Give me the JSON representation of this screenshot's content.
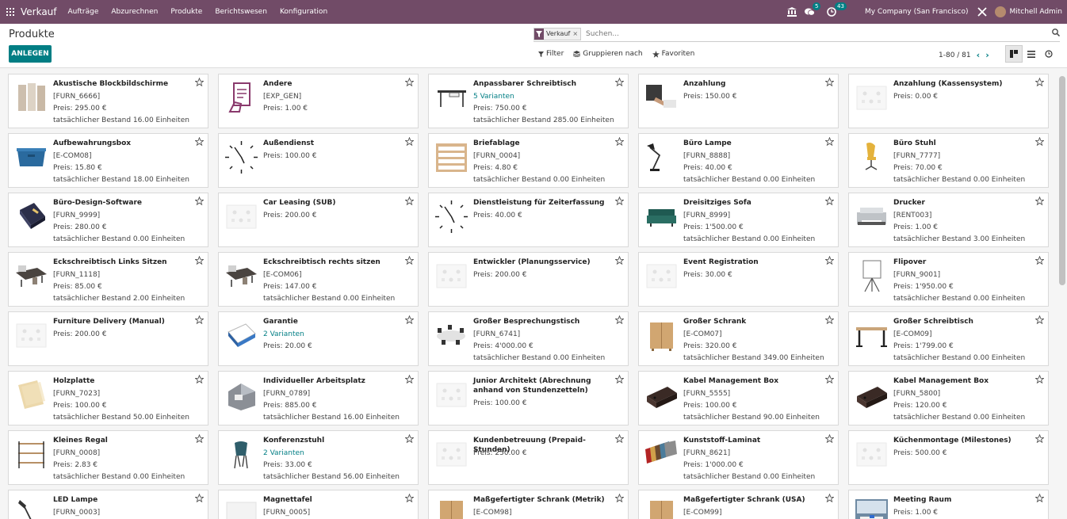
{
  "navbar": {
    "app": "Verkauf",
    "menu": [
      "Aufträge",
      "Abzurechnen",
      "Produkte",
      "Berichtswesen",
      "Konfiguration"
    ],
    "messages_count": "5",
    "activities_count": "43",
    "company": "My Company (San Francisco)",
    "user": "Mitchell Admin"
  },
  "control": {
    "title": "Produkte",
    "create_label": "ANLEGEN",
    "facet": "Verkauf",
    "search_placeholder": "Suchen...",
    "filter_label": "Filter",
    "group_label": "Gruppieren nach",
    "favorites_label": "Favoriten",
    "pager": "1-80 / 81"
  },
  "products": [
    {
      "name": "Akustische Blockbildschirme",
      "lines": [
        "[FURN_6666]",
        "Preis: 295.00 €",
        "tatsächlicher Bestand 16.00 Einheiten"
      ],
      "img": "panels"
    },
    {
      "name": "Andere",
      "lines": [
        "[EXP_GEN]",
        "Preis: 1.00 €"
      ],
      "img": "hand-doc"
    },
    {
      "name": "Anpassbarer Schreibtisch",
      "lines": [
        "5 Varianten",
        "Preis: 750.00 €",
        "tatsächlicher Bestand 285.00 Einheiten"
      ],
      "variant_line": 0,
      "img": "desk"
    },
    {
      "name": "Anzahlung",
      "lines": [
        "Preis: 150.00 €"
      ],
      "img": "handshake"
    },
    {
      "name": "Anzahlung (Kassensystem)",
      "lines": [
        "Preis: 0.00 €"
      ],
      "img": "placeholder"
    },
    {
      "name": "Aufbewahrungsbox",
      "lines": [
        "[E-COM08]",
        "Preis: 15.80 €",
        "tatsächlicher Bestand 18.00 Einheiten"
      ],
      "img": "box-blue"
    },
    {
      "name": "Außendienst",
      "lines": [
        "Preis: 100.00 €"
      ],
      "img": "clock"
    },
    {
      "name": "Briefablage",
      "lines": [
        "[FURN_0004]",
        "Preis: 4.80 €",
        "tatsächlicher Bestand 0.00 Einheiten"
      ],
      "img": "shelf-tray"
    },
    {
      "name": "Büro Lampe",
      "lines": [
        "[FURN_8888]",
        "Preis: 40.00 €",
        "tatsächlicher Bestand 0.00 Einheiten"
      ],
      "img": "lamp"
    },
    {
      "name": "Büro Stuhl",
      "lines": [
        "[FURN_7777]",
        "Preis: 70.00 €",
        "tatsächlicher Bestand 0.00 Einheiten"
      ],
      "img": "chair-yellow"
    },
    {
      "name": "Büro-Design-Software",
      "lines": [
        "[FURN_9999]",
        "Preis: 280.00 €",
        "tatsächlicher Bestand 0.00 Einheiten"
      ],
      "img": "software-box"
    },
    {
      "name": "Car Leasing (SUB)",
      "lines": [
        "Preis: 200.00 €"
      ],
      "img": "placeholder"
    },
    {
      "name": "Dienstleistung für Zeiterfassung",
      "lines": [
        "Preis: 40.00 €"
      ],
      "img": "clock"
    },
    {
      "name": "Dreisitziges Sofa",
      "lines": [
        "[FURN_8999]",
        "Preis: 1'500.00 €",
        "tatsächlicher Bestand 0.00 Einheiten"
      ],
      "img": "sofa"
    },
    {
      "name": "Drucker",
      "lines": [
        "[RENT003]",
        "Preis: 1.00 €",
        "tatsächlicher Bestand 3.00 Einheiten"
      ],
      "img": "printer"
    },
    {
      "name": "Eckschreibtisch Links Sitzen",
      "lines": [
        "[FURN_1118]",
        "Preis: 85.00 €",
        "tatsächlicher Bestand 2.00 Einheiten"
      ],
      "img": "corner-desk"
    },
    {
      "name": "Eckschreibtisch rechts sitzen",
      "lines": [
        "[E-COM06]",
        "Preis: 147.00 €",
        "tatsächlicher Bestand 0.00 Einheiten"
      ],
      "img": "corner-desk"
    },
    {
      "name": "Entwickler (Planungsservice)",
      "lines": [
        "Preis: 200.00 €"
      ],
      "img": "placeholder"
    },
    {
      "name": "Event Registration",
      "lines": [
        "Preis: 30.00 €"
      ],
      "img": "placeholder"
    },
    {
      "name": "Flipover",
      "lines": [
        "[FURN_9001]",
        "Preis: 1'950.00 €",
        "tatsächlicher Bestand 0.00 Einheiten"
      ],
      "img": "flipchart"
    },
    {
      "name": "Furniture Delivery (Manual)",
      "lines": [
        "Preis: 200.00 €"
      ],
      "img": "placeholder"
    },
    {
      "name": "Garantie",
      "lines": [
        "2 Varianten",
        "Preis: 20.00 €"
      ],
      "variant_line": 0,
      "img": "warranty"
    },
    {
      "name": "Großer Besprechungstisch",
      "lines": [
        "[FURN_6741]",
        "Preis: 4'000.00 €",
        "tatsächlicher Bestand 0.00 Einheiten"
      ],
      "img": "meeting-table"
    },
    {
      "name": "Großer Schrank",
      "lines": [
        "[E-COM07]",
        "Preis: 320.00 €",
        "tatsächlicher Bestand 349.00 Einheiten"
      ],
      "img": "cabinet"
    },
    {
      "name": "Großer Schreibtisch",
      "lines": [
        "[E-COM09]",
        "Preis: 1'799.00 €",
        "tatsächlicher Bestand 0.00 Einheiten"
      ],
      "img": "big-desk"
    },
    {
      "name": "Holzplatte",
      "lines": [
        "[FURN_7023]",
        "Preis: 100.00 €",
        "tatsächlicher Bestand 50.00 Einheiten"
      ],
      "img": "wood-board"
    },
    {
      "name": "Individueller Arbeitsplatz",
      "lines": [
        "[FURN_0789]",
        "Preis: 885.00 €",
        "tatsächlicher Bestand 16.00 Einheiten"
      ],
      "img": "workspace"
    },
    {
      "name": "Junior Architekt (Abrechnung anhand von Stundenzetteln)",
      "lines": [
        "Preis: 100.00 €"
      ],
      "two_line": true,
      "img": "placeholder"
    },
    {
      "name": "Kabel Management Box",
      "lines": [
        "[FURN_5555]",
        "Preis: 100.00 €",
        "tatsächlicher Bestand 90.00 Einheiten"
      ],
      "img": "cable-box"
    },
    {
      "name": "Kabel Management Box",
      "lines": [
        "[FURN_5800]",
        "Preis: 120.00 €",
        "tatsächlicher Bestand 0.00 Einheiten"
      ],
      "img": "cable-box"
    },
    {
      "name": "Kleines Regal",
      "lines": [
        "[FURN_0008]",
        "Preis: 2.83 €",
        "tatsächlicher Bestand 0.00 Einheiten"
      ],
      "img": "small-shelf"
    },
    {
      "name": "Konferenzstuhl",
      "lines": [
        "2 Varianten",
        "Preis: 33.00 €",
        "tatsächlicher Bestand 56.00 Einheiten"
      ],
      "variant_line": 0,
      "img": "conf-chair"
    },
    {
      "name": "Kundenbetreuung (Prepaid-Stunden)",
      "lines": [
        "Preis: 250.00 €"
      ],
      "img": "placeholder"
    },
    {
      "name": "Kunststoff-Laminat",
      "lines": [
        "[FURN_8621]",
        "Preis: 1'000.00 €",
        "tatsächlicher Bestand 0.00 Einheiten"
      ],
      "img": "laminate"
    },
    {
      "name": "Küchenmontage (Milestones)",
      "lines": [
        "Preis: 500.00 €"
      ],
      "img": "placeholder"
    },
    {
      "name": "LED Lampe",
      "lines": [
        "[FURN_0003]"
      ],
      "img": "led-lamp"
    },
    {
      "name": "Magnettafel",
      "lines": [
        "[FURN_0005]"
      ],
      "img": "whiteboard"
    },
    {
      "name": "Maßgefertigter Schrank (Metrik)",
      "lines": [
        "[E-COM98]"
      ],
      "img": "cabinet"
    },
    {
      "name": "Maßgefertigter Schrank (USA)",
      "lines": [
        "[E-COM99]"
      ],
      "img": "cabinet"
    },
    {
      "name": "Meeting Raum",
      "lines": [
        "Preis: 1.00 €"
      ],
      "img": "meeting-room"
    }
  ]
}
